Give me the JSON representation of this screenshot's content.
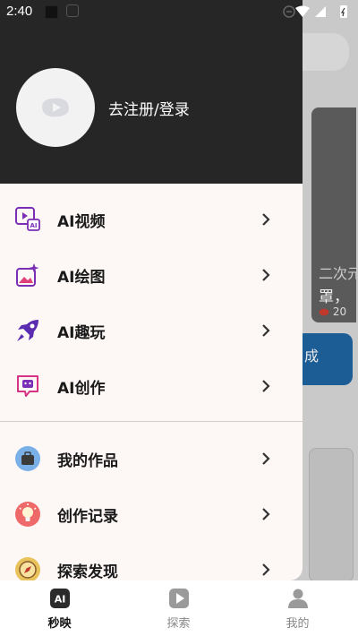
{
  "status_bar": {
    "time": "2:40"
  },
  "profile": {
    "login_label": "去注册/登录"
  },
  "menu": {
    "ai_items": [
      {
        "label": "AI视频",
        "icon": "video-icon"
      },
      {
        "label": "AI绘图",
        "icon": "paint-icon"
      },
      {
        "label": "AI趣玩",
        "icon": "rocket-icon"
      },
      {
        "label": "AI创作",
        "icon": "robot-chat-icon"
      }
    ],
    "user_items": [
      {
        "label": "我的作品",
        "icon": "briefcase-icon"
      },
      {
        "label": "创作记录",
        "icon": "bulb-icon"
      },
      {
        "label": "探索发现",
        "icon": "compass-icon"
      }
    ]
  },
  "background": {
    "card_line1": "二次元",
    "card_line2": "罩，",
    "card_views": "20",
    "blue_button": "成"
  },
  "bottom_nav": {
    "tabs": [
      {
        "label": "秒映",
        "icon": "ai-icon",
        "active": true
      },
      {
        "label": "探索",
        "icon": "play-icon",
        "active": false
      },
      {
        "label": "我的",
        "icon": "user-icon",
        "active": false
      }
    ]
  },
  "colors": {
    "accent_purple": "#7a2fb5",
    "header_bg": "#262626",
    "drawer_bg": "#fdf7f6"
  }
}
